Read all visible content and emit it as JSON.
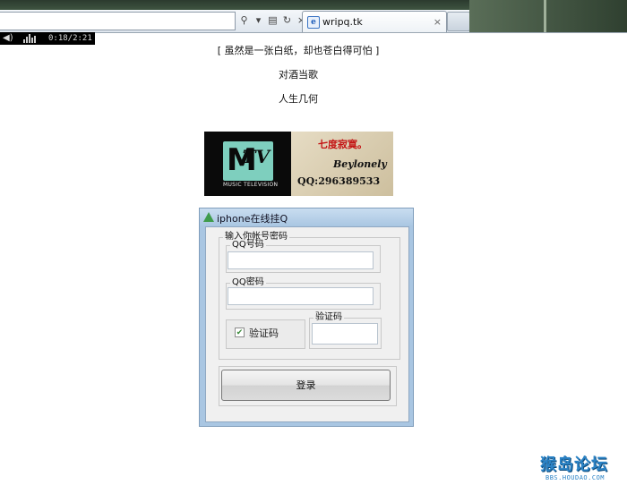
{
  "browser": {
    "tab_title": "wripq.tk",
    "tab_favicon_glyph": "e",
    "tab_close_glyph": "×",
    "address_icons": [
      "search-icon",
      "dropdown-icon",
      "compat-icon",
      "refresh-icon",
      "stop-icon"
    ],
    "icon_glyphs": {
      "search": "⚲",
      "dropdown": "▾",
      "compat": "▤",
      "refresh": "↻",
      "stop": "×"
    }
  },
  "player": {
    "volume_glyph": "◀)",
    "time": "0:18/2:21"
  },
  "page": {
    "line1": "[ 虽然是一张白纸，却也苍白得可怕 ]",
    "line2": "对酒当歌",
    "line3": "人生几何"
  },
  "banner": {
    "logo_m": "M",
    "logo_tv": "TV",
    "logo_sub": "MUSIC TELEVISION",
    "title": "七度寂寞。",
    "name": "Beylonely",
    "qq": "QQ:296389533"
  },
  "window": {
    "title": "iphone在线挂Q",
    "group_main": "输入你帐号密码",
    "group_qq_number": "QQ号码",
    "group_qq_password": "QQ密码",
    "captcha_checkbox_label": "验证码",
    "captcha_checked_glyph": "✔",
    "group_captcha": "验证码",
    "qq_number_value": "",
    "qq_password_value": "",
    "captcha_value": "",
    "login_label": "登录"
  },
  "watermark": {
    "text": "猴岛论坛",
    "url": "BBS.HOUDAO.COM"
  },
  "colors": {
    "window_frame": "#a9c6e2",
    "watermark": "#2b83c6",
    "banner_title": "#c41414",
    "mtv_logo": "#7ecfbe"
  }
}
